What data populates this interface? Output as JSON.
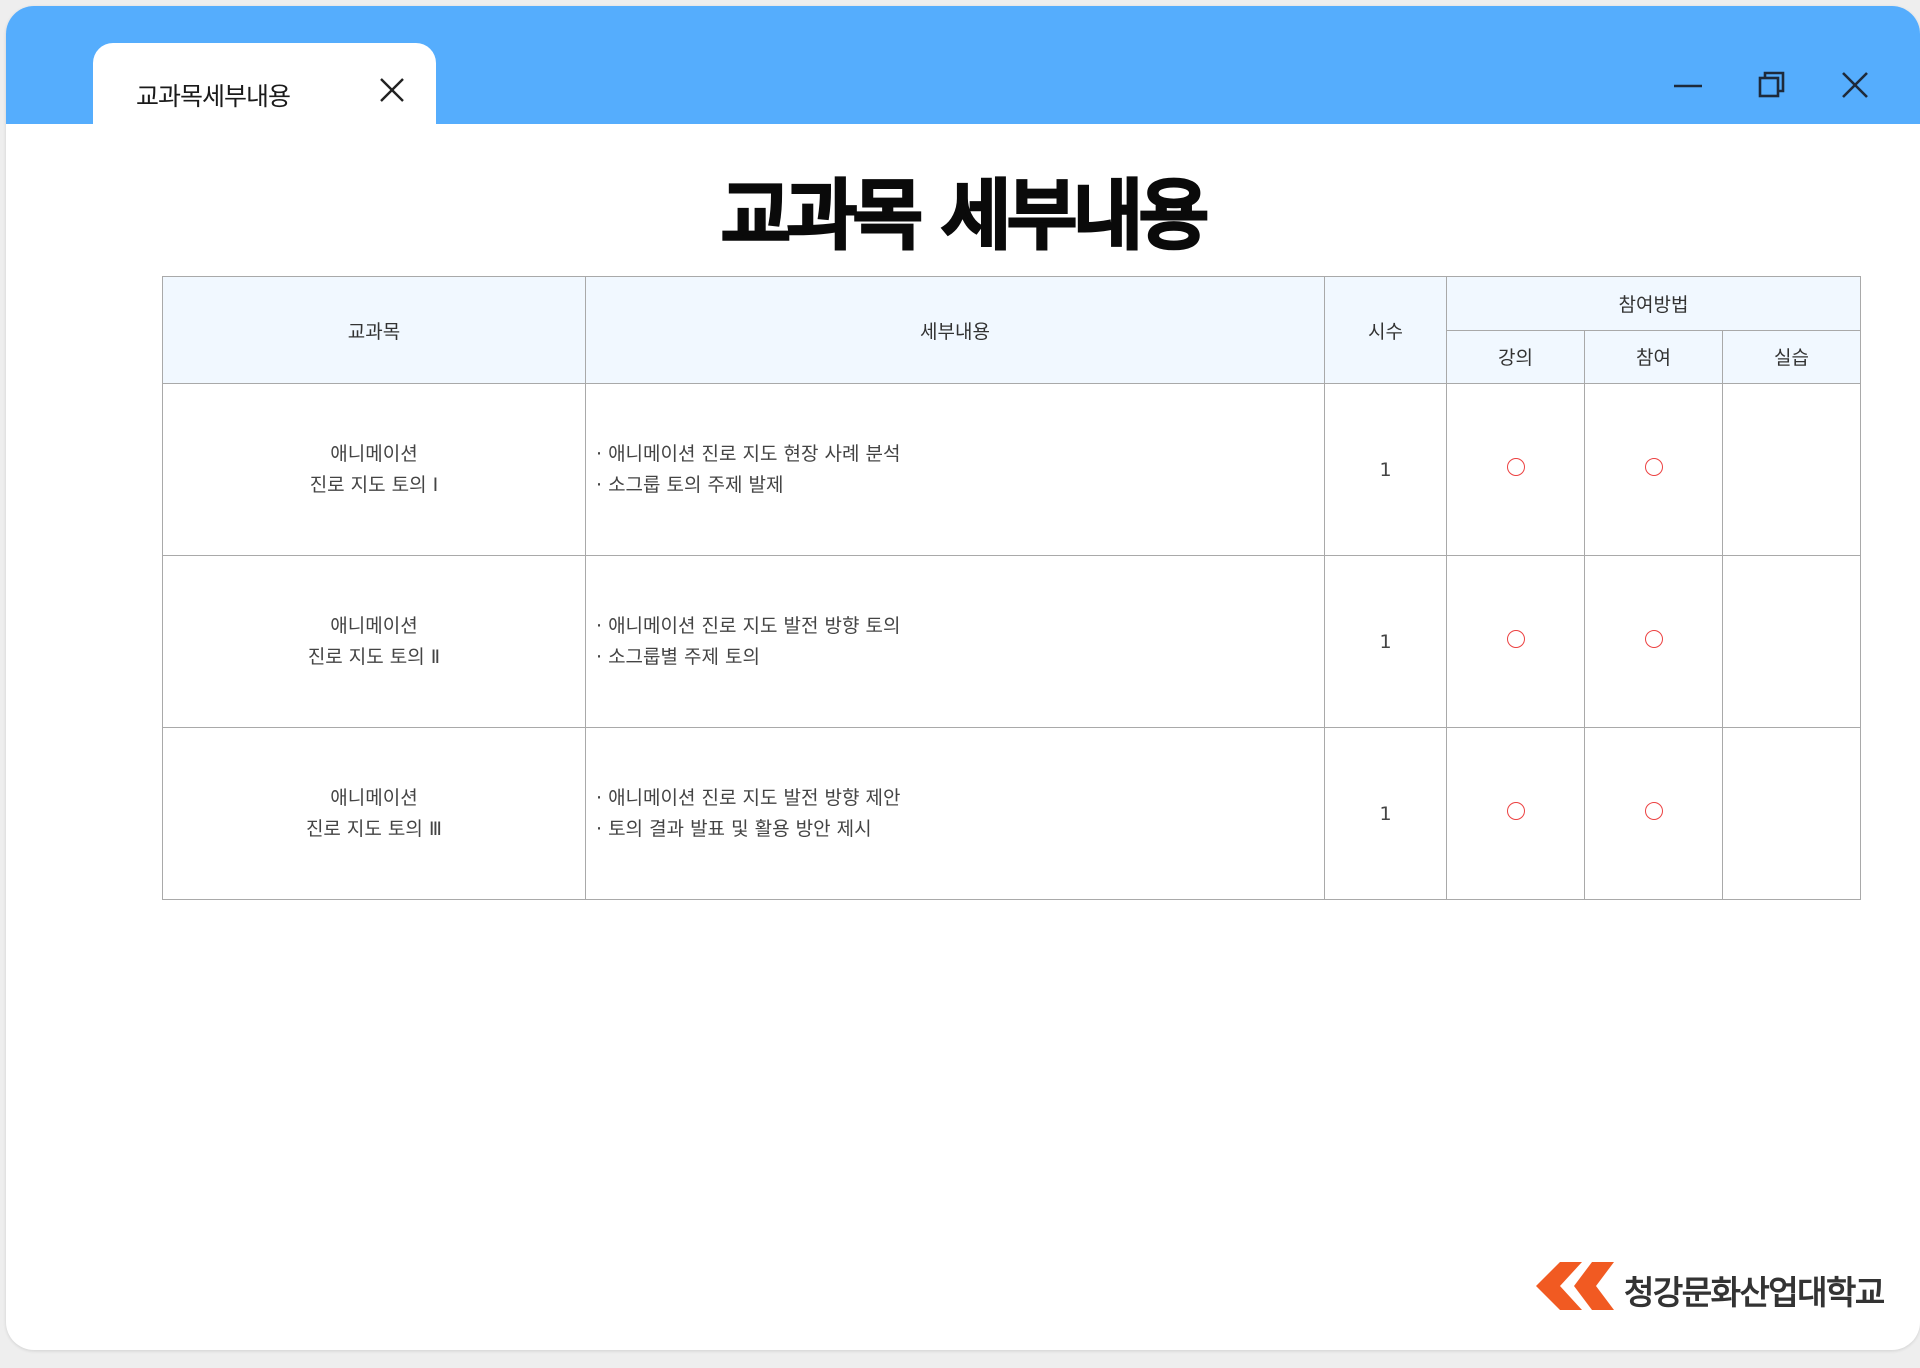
{
  "tab": {
    "label": "교과목세부내용"
  },
  "icons": {
    "tab_close": "close-icon",
    "minimize": "minimize-icon",
    "maximize": "restore-icon",
    "close": "close-icon"
  },
  "page": {
    "title": "교과목 세부내용"
  },
  "table": {
    "headers": {
      "subject": "교과목",
      "detail": "세부내용",
      "hours": "시수",
      "method": "참여방법",
      "lecture": "강의",
      "participation": "참여",
      "practice": "실습"
    },
    "rows": [
      {
        "subject_line1": "애니메이션",
        "subject_line2": "진로 지도 토의 Ⅰ",
        "detail_line1": "· 애니메이션 진로 지도 현장 사례 분석",
        "detail_line2": "· 소그룹 토의 주제 발제",
        "hours": "1",
        "lecture": "○",
        "participation": "○",
        "practice": ""
      },
      {
        "subject_line1": "애니메이션",
        "subject_line2": "진로 지도 토의 Ⅱ",
        "detail_line1": "· 애니메이션 진로 지도 발전 방향 토의",
        "detail_line2": "· 소그룹별 주제 토의",
        "hours": "1",
        "lecture": "○",
        "participation": "○",
        "practice": ""
      },
      {
        "subject_line1": "애니메이션",
        "subject_line2": "진로 지도 토의 Ⅲ",
        "detail_line1": "·  애니메이션 진로 지도 발전 방향 제안",
        "detail_line2": "·  토의 결과 발표 및 활용 방안 제시",
        "hours": "1",
        "lecture": "○",
        "participation": "○",
        "practice": ""
      }
    ]
  },
  "logo": {
    "text": "청강문화산업대학교",
    "mark_color": "#f15a22"
  },
  "colors": {
    "titlebar": "#55adfd",
    "header_bg": "#f1f8ff",
    "mark_circle": "#ec4141"
  }
}
